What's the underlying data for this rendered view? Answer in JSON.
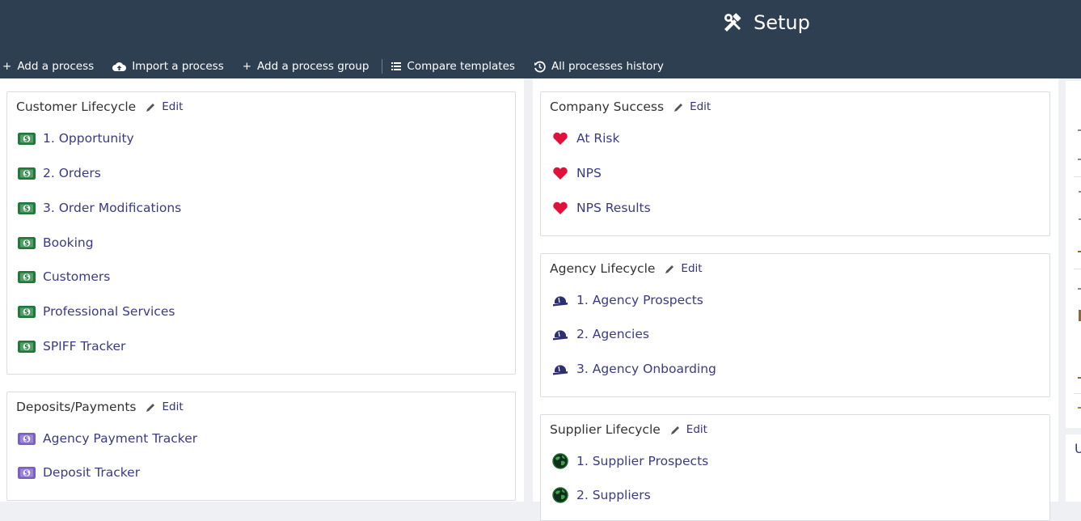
{
  "header": {
    "title": "Setup",
    "title_icon": "tools-icon"
  },
  "toolbar": {
    "add_process": "Add a process",
    "import_process": "Import a process",
    "add_group": "Add a process group",
    "compare_templates": "Compare templates",
    "history": "All processes history"
  },
  "groups": {
    "customer": {
      "title": "Customer Lifecycle",
      "edit": "Edit",
      "icon": "money-icon",
      "items": [
        "1. Opportunity",
        "2. Orders",
        "3. Order Modifications",
        "Booking",
        "Customers",
        "Professional Services",
        "SPIFF Tracker"
      ]
    },
    "deposits": {
      "title": "Deposits/Payments",
      "edit": "Edit",
      "icon": "money-icon",
      "items": [
        "Agency Payment Tracker",
        "Deposit Tracker"
      ]
    },
    "success": {
      "title": "Company Success",
      "edit": "Edit",
      "icon": "heart-icon",
      "items": [
        "At Risk",
        "NPS",
        "NPS Results"
      ]
    },
    "agency": {
      "title": "Agency Lifecycle",
      "edit": "Edit",
      "icon": "hard-hat-icon",
      "items": [
        "1. Agency Prospects",
        "2. Agencies",
        "3. Agency Onboarding"
      ]
    },
    "supplier": {
      "title": "Supplier Lifecycle",
      "edit": "Edit",
      "icon": "globe-icon",
      "items": [
        "1. Supplier Prospects",
        "2. Suppliers"
      ]
    }
  },
  "right_panel": {
    "partial_letter": "U"
  },
  "colors": {
    "header_bg": "#2f3f52",
    "link": "#3a3a86",
    "money_green": "#1f7a3a",
    "money_purple": "#7b5fc7",
    "heart_red": "#e0123c",
    "hat_navy": "#2e2f6e",
    "globe_green": "#1f6b2e"
  }
}
